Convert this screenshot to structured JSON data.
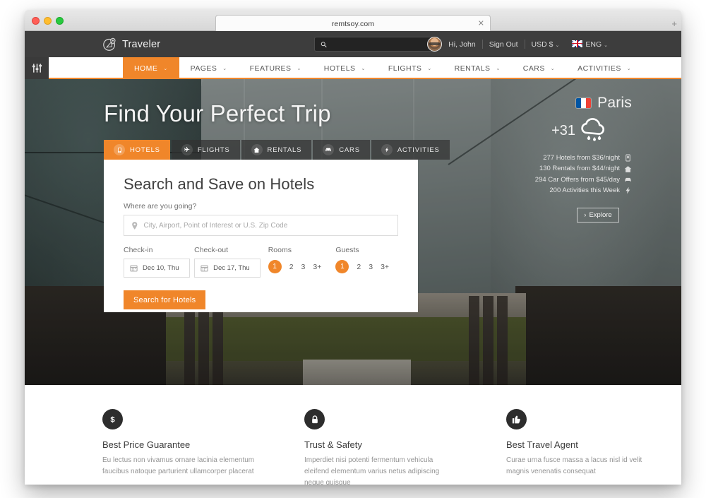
{
  "browser": {
    "tab_title": "remtsoy.com",
    "close_label": "✕",
    "newtab_label": "+"
  },
  "header": {
    "brand": "Traveler",
    "search_placeholder": "",
    "greeting": "Hi, John",
    "sign_out": "Sign Out",
    "currency": "USD $",
    "language": "ENG",
    "caret": "⌄"
  },
  "nav": {
    "items": [
      {
        "label": "HOME",
        "caret": "⌄",
        "active": true
      },
      {
        "label": "PAGES",
        "caret": "⌄",
        "active": false
      },
      {
        "label": "FEATURES",
        "caret": "⌄",
        "active": false
      },
      {
        "label": "HOTELS",
        "caret": "⌄",
        "active": false
      },
      {
        "label": "FLIGHTS",
        "caret": "⌄",
        "active": false
      },
      {
        "label": "RENTALS",
        "caret": "⌄",
        "active": false
      },
      {
        "label": "CARS",
        "caret": "⌄",
        "active": false
      },
      {
        "label": "ACTIVITIES",
        "caret": "⌄",
        "active": false
      }
    ]
  },
  "hero": {
    "title": "Find Your Perfect Trip",
    "tabs": [
      {
        "label": "HOTELS",
        "icon": "hotel-icon",
        "active": true
      },
      {
        "label": "FLIGHTS",
        "icon": "plane-icon",
        "active": false
      },
      {
        "label": "RENTALS",
        "icon": "home-icon",
        "active": false
      },
      {
        "label": "CARS",
        "icon": "car-icon",
        "active": false
      },
      {
        "label": "ACTIVITIES",
        "icon": "bolt-icon",
        "active": false
      }
    ]
  },
  "search_card": {
    "title": "Search and Save on Hotels",
    "destination_label": "Where are you going?",
    "destination_value": "",
    "destination_placeholder": "City, Airport, Point of Interest or U.S. Zip Code",
    "checkin_label": "Check-in",
    "checkin_value": "Dec 10, Thu",
    "checkout_label": "Check-out",
    "checkout_value": "Dec 17, Thu",
    "rooms_label": "Rooms",
    "rooms_options": [
      "1",
      "2",
      "3",
      "3+"
    ],
    "rooms_selected": "1",
    "guests_label": "Guests",
    "guests_options": [
      "1",
      "2",
      "3",
      "3+"
    ],
    "guests_selected": "1",
    "submit_label": "Search for Hotels"
  },
  "city_widget": {
    "city": "Paris",
    "flag": "france-flag",
    "temperature": "+31",
    "weather_icon": "rain-cloud-icon",
    "stats": [
      {
        "icon": "hotel-icon",
        "text": "277 Hotels from $36/night"
      },
      {
        "icon": "home-icon",
        "text": "130 Rentals from $44/night"
      },
      {
        "icon": "car-icon",
        "text": "294 Car Offers from $45/day"
      },
      {
        "icon": "bolt-icon",
        "text": "200 Activities this Week"
      }
    ],
    "explore_label": "Explore",
    "explore_caret": "›"
  },
  "features": [
    {
      "icon": "dollar-icon",
      "title": "Best Price Guarantee",
      "desc": "Eu lectus non vivamus ornare lacinia elementum faucibus natoque parturient ullamcorper placerat"
    },
    {
      "icon": "lock-icon",
      "title": "Trust & Safety",
      "desc": "Imperdiet nisi potenti fermentum vehicula eleifend elementum varius netus adipiscing neque quisque"
    },
    {
      "icon": "thumbs-up-icon",
      "title": "Best Travel Agent",
      "desc": "Curae urna fusce massa a lacus nisl id velit magnis venenatis consequat"
    }
  ],
  "colors": {
    "accent": "#f0862a",
    "header_bg": "#3d3d3d",
    "dark_icon": "#2d2d2d"
  }
}
